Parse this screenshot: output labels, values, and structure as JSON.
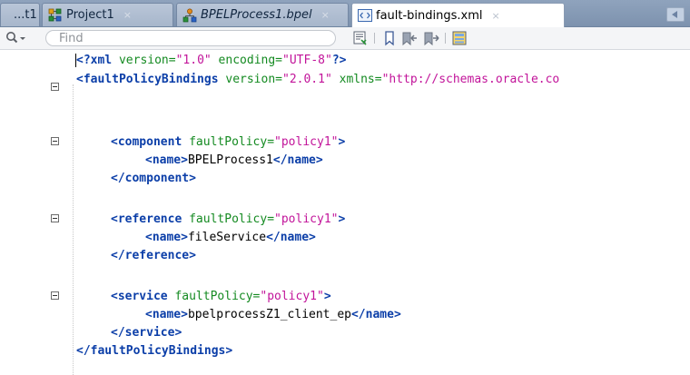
{
  "tabs": [
    {
      "label": "...t1",
      "icon": "project-icon"
    },
    {
      "label": "Project1",
      "icon": "project-icon"
    },
    {
      "label": "BPELProcess1.bpel",
      "icon": "bpel-process-icon"
    },
    {
      "label": "fault-bindings.xml",
      "icon": "xml-file-icon",
      "active": true
    }
  ],
  "close_glyph": "×",
  "search": {
    "placeholder": "Find"
  },
  "code": {
    "line1": {
      "pi_open": "<?xml",
      "a1": " version=",
      "v1": "\"1.0\"",
      "a2": " encoding=",
      "v2": "\"UTF-8\"",
      "pi_close": "?>"
    },
    "line2": {
      "tag": "<faultPolicyBindings",
      "a1": " version=",
      "v1": "\"2.0.1\"",
      "a2": " xmlns=",
      "v2": "\"http://schemas.oracle.co"
    },
    "component": {
      "open": "<component",
      "attr": " faultPolicy=",
      "val": "\"policy1\"",
      "close": ">",
      "name_open": "<name>",
      "name": "BPELProcess1",
      "name_close": "</name>",
      "end": "</component>"
    },
    "reference": {
      "open": "<reference",
      "attr": " faultPolicy=",
      "val": "\"policy1\"",
      "close": ">",
      "name_open": "<name>",
      "name": "fileService",
      "name_close": "</name>",
      "end": "</reference>"
    },
    "service": {
      "open": "<service",
      "attr": " faultPolicy=",
      "val": "\"policy1\"",
      "close": ">",
      "name_open": "<name>",
      "name": "bpelprocessZ1_client_ep",
      "name_close": "</name>",
      "end": "</service>"
    },
    "root_end": "</faultPolicyBindings>"
  },
  "colors": {
    "tag": "#0b3ea8",
    "attribute": "#148a21",
    "value": "#c2149a",
    "tabbar": "#8fa3bd"
  }
}
